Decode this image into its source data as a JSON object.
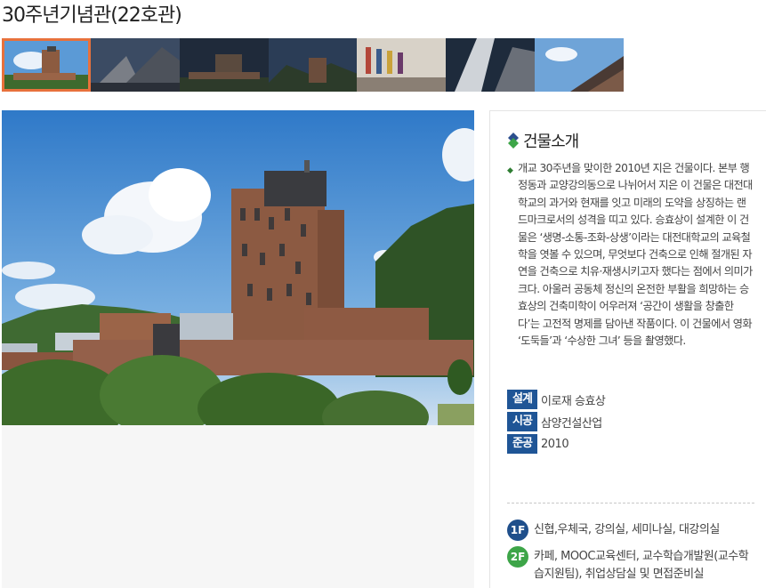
{
  "page": {
    "title": "30주년기념관(22호관)"
  },
  "thumbnails": [
    {
      "label": "thumbnail-1",
      "active": true
    },
    {
      "label": "thumbnail-2",
      "active": false
    },
    {
      "label": "thumbnail-3",
      "active": false
    },
    {
      "label": "thumbnail-4",
      "active": false
    },
    {
      "label": "thumbnail-5",
      "active": false
    },
    {
      "label": "thumbnail-6",
      "active": false
    },
    {
      "label": "thumbnail-7",
      "active": false
    }
  ],
  "info": {
    "section_title": "건물소개",
    "description": "개교 30주년을 맞이한 2010년 지은 건물이다. 본부 행정동과 교양강의동으로 나뉘어서 지은 이 건물은 대전대학교의 과거와 현재를 잇고 미래의 도약을 상징하는 랜드마크로서의 성격을 띠고 있다. 승효상이 설계한 이 건물은 ‘생명-소통-조화-상생’이라는 대전대학교의 교육철학을 엿볼 수 있으며, 무엇보다 건축으로 인해 절개된 자연을 건축으로 치유·재생시키고자 했다는 점에서 의미가 크다. 아울러 공동체 정신의 온전한 부활을 희망하는 승효상의 건축미학이 어우러져 ‘공간이 생활을 창출한다’는 고전적 명제를 담아낸 작품이다. 이 건물에서 영화 ‘도둑들’과 ‘수상한 그녀’ 등을 촬영했다.",
    "meta": [
      {
        "tag": "설계",
        "value": "이로재 승효상"
      },
      {
        "tag": "시공",
        "value": "삼양건설산업"
      },
      {
        "tag": "준공",
        "value": "2010"
      }
    ],
    "floors": [
      {
        "badge": "1F",
        "color": "#1f4f8b",
        "text": "신협,우체국, 강의실, 세미나실, 대강의실"
      },
      {
        "badge": "2F",
        "color": "#3da548",
        "text": "카페, MOOC교육센터, 교수학습개발원(교수학습지원팀), 취업상담실 및 면접준비실"
      }
    ]
  }
}
